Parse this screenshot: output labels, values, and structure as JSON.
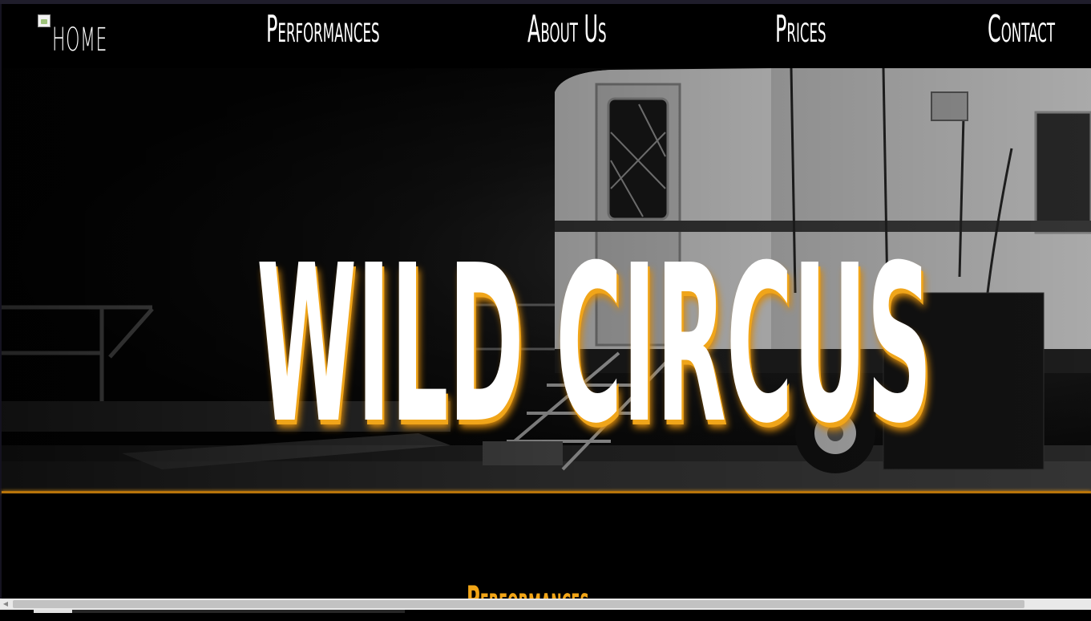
{
  "nav": {
    "home_label": "home",
    "links": [
      "Performances",
      "About Us",
      "Prices",
      "Contact"
    ]
  },
  "hero": {
    "title": "Wild Circus"
  },
  "section": {
    "heading": "Performances"
  },
  "colors": {
    "accent": "#f0a51a",
    "background": "#000000",
    "text": "#ffffff"
  }
}
